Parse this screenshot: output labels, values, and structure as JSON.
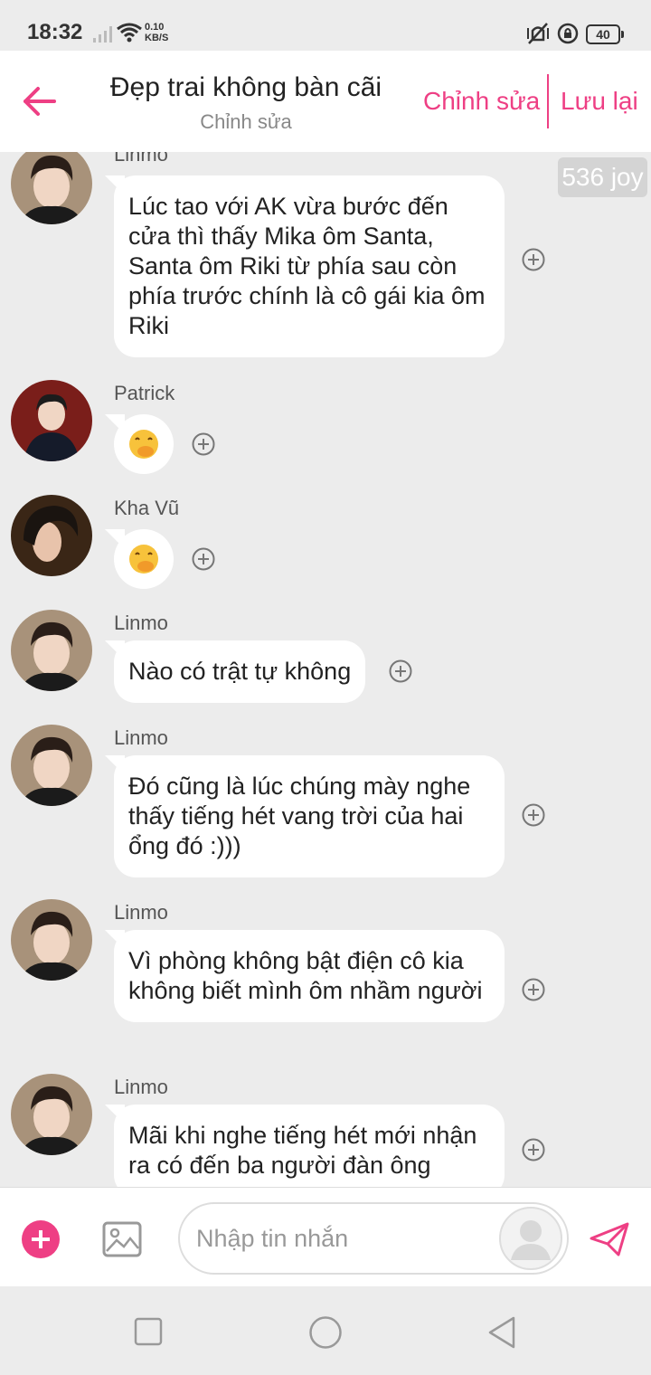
{
  "status_bar": {
    "time": "18:32",
    "speed_value": "0.10",
    "speed_unit": "KB/S",
    "battery": "40"
  },
  "header": {
    "title": "Đẹp trai không bàn cãi",
    "subtitle": "Chỉnh sửa",
    "edit_label": "Chỉnh sửa",
    "save_label": "Lưu lại",
    "accent_color": "#ee3f84"
  },
  "badge": {
    "label": "536 joy"
  },
  "messages": [
    {
      "sender": "Linmo",
      "text": "Lúc tao với AK vừa bước đến cửa thì thấy Mika ôm Santa, Santa ôm Riki từ phía sau còn phía trước chính là cô gái kia ôm Riki"
    },
    {
      "sender": "Patrick",
      "text": "🤭"
    },
    {
      "sender": "Kha Vũ",
      "text": "🤭"
    },
    {
      "sender": "Linmo",
      "text": "Nào có trật tự không"
    },
    {
      "sender": "Linmo",
      "text": "Đó cũng là lúc chúng mày nghe thấy tiếng hét vang trời của hai ổng đó :)))"
    },
    {
      "sender": "Linmo",
      "text": "Vì phòng không bật điện cô kia không biết mình ôm nhầm người"
    },
    {
      "sender": "Linmo",
      "text": "Mãi khi nghe tiếng hét mới nhận ra có đến ba người đàn ông"
    }
  ],
  "composer": {
    "placeholder": "Nhập tin nhắn",
    "value": ""
  },
  "icons": {
    "back": "arrow-left-icon",
    "add": "plus-icon",
    "image": "image-icon",
    "send": "send-icon",
    "reaction": "add-reaction-icon"
  }
}
